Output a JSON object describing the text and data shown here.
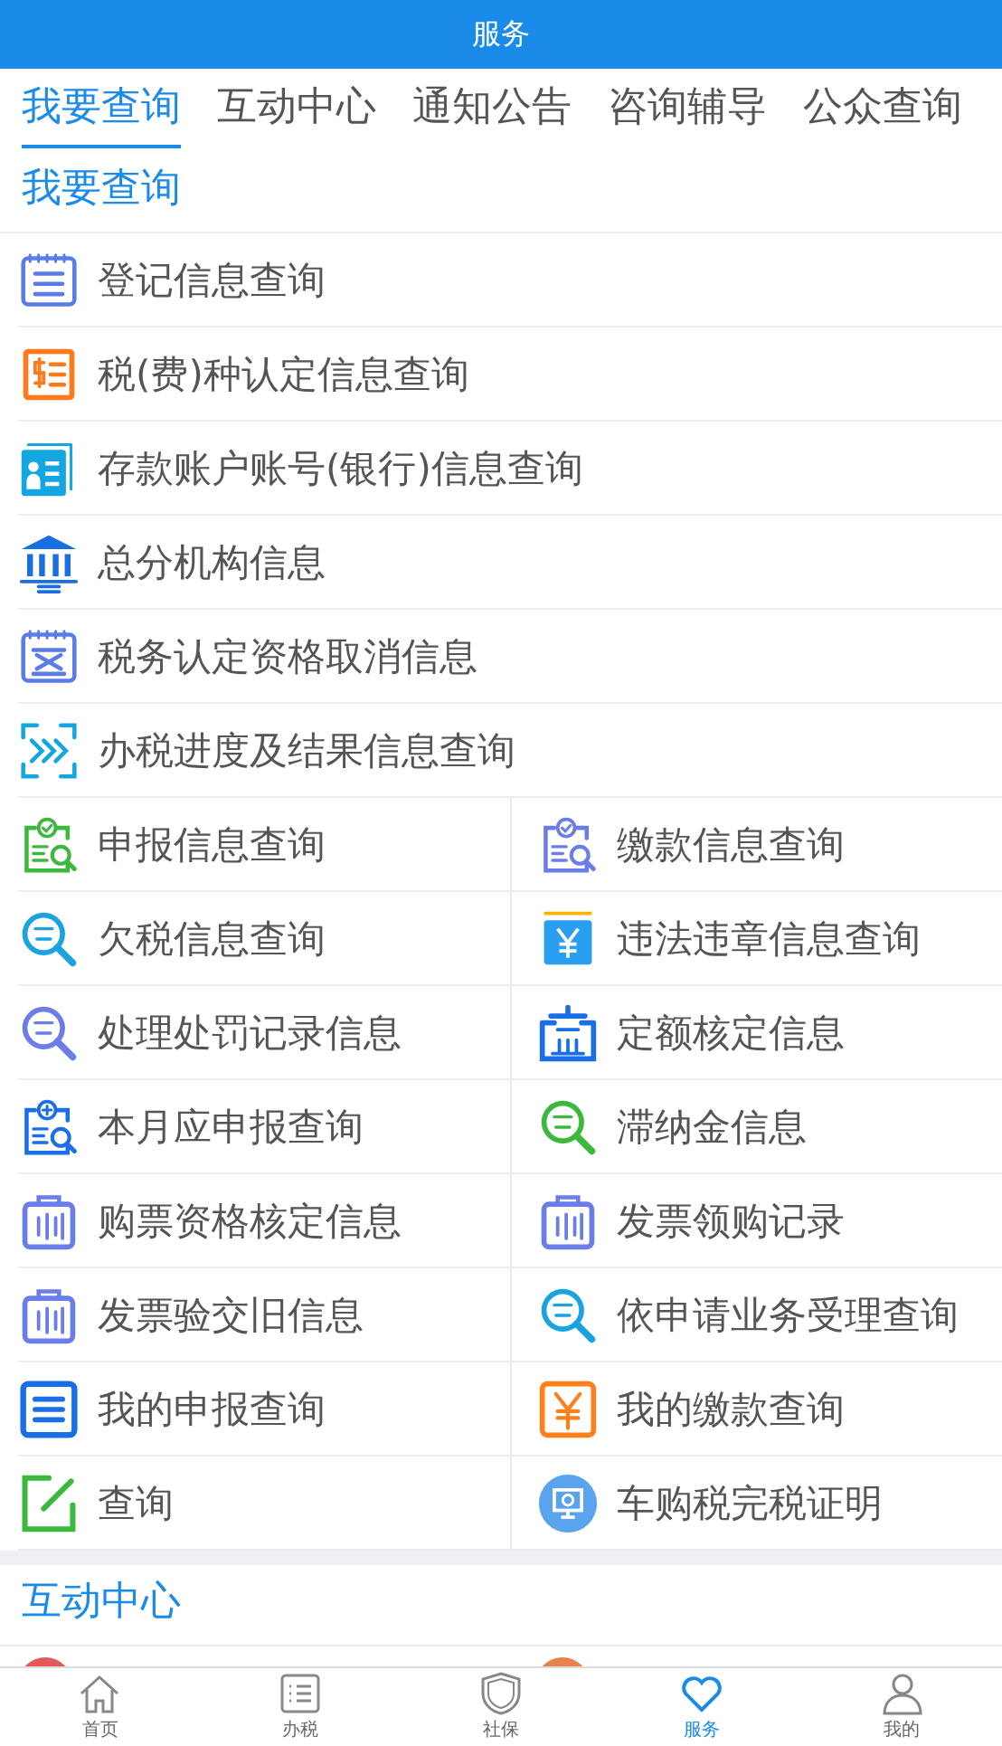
{
  "header": {
    "title": "服务"
  },
  "tabs": [
    {
      "label": "我要查询",
      "selected": true
    },
    {
      "label": "互动中心",
      "selected": false
    },
    {
      "label": "通知公告",
      "selected": false
    },
    {
      "label": "咨询辅导",
      "selected": false
    },
    {
      "label": "公众查询",
      "selected": false
    }
  ],
  "sections": [
    {
      "title": "我要查询",
      "list": [
        "登记信息查询",
        "税(费)种认定信息查询",
        "存款账户账号(银行)信息查询",
        "总分机构信息",
        "税务认定资格取消信息",
        "办税进度及结果信息查询"
      ],
      "grid": [
        "申报信息查询",
        "缴款信息查询",
        "欠税信息查询",
        "违法违章信息查询",
        "处理处罚记录信息",
        "定额核定信息",
        "本月应申报查询",
        "滞纳金信息",
        "购票资格核定信息",
        "发票领购记录",
        "发票验交旧信息",
        "依申请业务受理查询",
        "我的申报查询",
        "我的缴款查询",
        "查询",
        "车购税完税证明"
      ]
    },
    {
      "title": "互动中心",
      "peek": [
        {
          "color": "#e05a5a"
        },
        {
          "color": "#e8844a"
        }
      ]
    }
  ],
  "nav": [
    {
      "label": "首页",
      "selected": false
    },
    {
      "label": "办税",
      "selected": false
    },
    {
      "label": "社保",
      "selected": false
    },
    {
      "label": "服务",
      "selected": true
    },
    {
      "label": "我的",
      "selected": false
    }
  ]
}
